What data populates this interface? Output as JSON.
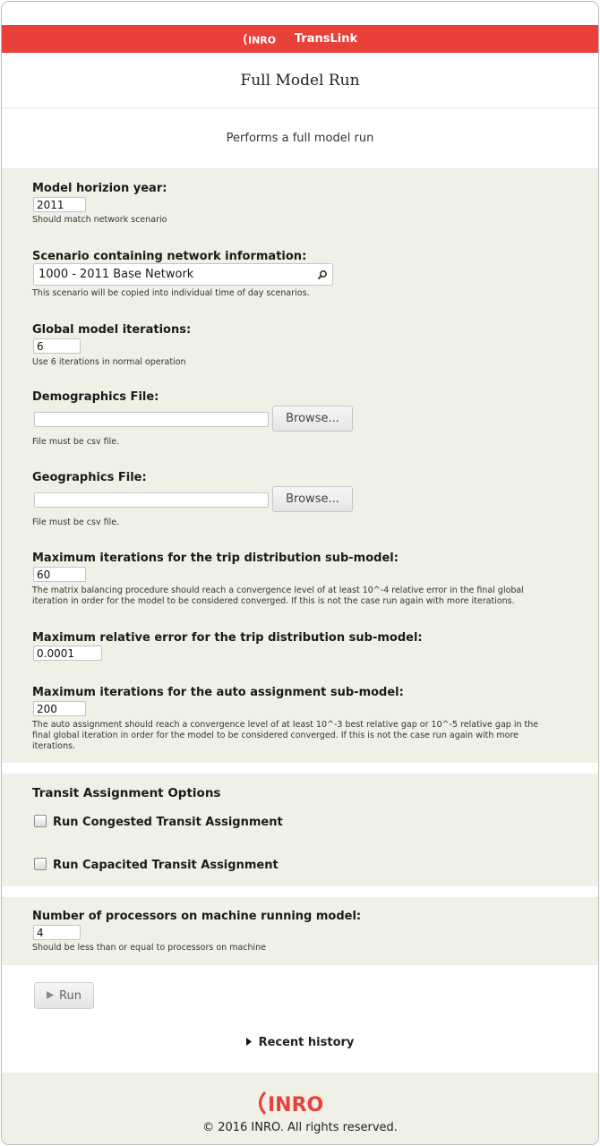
{
  "header": {
    "brand": "INRO",
    "app_name": "TransLink",
    "page_title": "Full Model Run",
    "description": "Performs a full model run"
  },
  "form": {
    "horizon_year": {
      "label": "Model horizion year:",
      "value": "2011",
      "hint": "Should match network scenario"
    },
    "scenario": {
      "label": "Scenario containing network information:",
      "value": "1000 - 2011 Base Network",
      "hint": "This scenario will be copied into individual time of day scenarios."
    },
    "global_iterations": {
      "label": "Global model iterations:",
      "value": "6",
      "hint": "Use 6 iterations in normal operation"
    },
    "demographics_file": {
      "label": "Demographics File:",
      "value": "",
      "button": "Browse...",
      "hint": "File must be csv file."
    },
    "geographics_file": {
      "label": "Geographics File:",
      "value": "",
      "button": "Browse...",
      "hint": "File must be csv file."
    },
    "trip_dist_iterations": {
      "label": "Maximum iterations for the trip distribution sub-model:",
      "value": "60",
      "hint_line1": "The matrix balancing procedure should reach a convergence level of at least 10^-4 relative error in the final global",
      "hint_line2": "iteration in order for the model to be considered converged. If this is not the case run again with more iterations."
    },
    "trip_dist_error": {
      "label": "Maximum relative error for the trip distribution sub-model:",
      "value": "0.0001"
    },
    "auto_assign_iterations": {
      "label": "Maximum iterations for the auto assignment sub-model:",
      "value": "200",
      "hint_line1": "The auto assignment should reach a convergence level of at least 10^-3 best relative gap or 10^-5 relative gap in the",
      "hint_line2": "final global iteration in order for the model to be considered converged. If this is not the case run again with more",
      "hint_line3": "iterations."
    }
  },
  "transit": {
    "heading": "Transit Assignment Options",
    "congested_label": "Run Congested Transit Assignment",
    "congested_checked": false,
    "capacited_label": "Run Capacited Transit Assignment",
    "capacited_checked": false
  },
  "processors": {
    "label": "Number of processors on machine running model:",
    "value": "4",
    "hint": "Should be less than or equal to processors on machine"
  },
  "actions": {
    "run_label": "Run",
    "history_label": "Recent history"
  },
  "footer": {
    "brand": "INRO",
    "copyright": "© 2016 INRO. All rights reserved."
  },
  "colors": {
    "banner": "#e8413a",
    "panel": "#f0f0e6"
  }
}
